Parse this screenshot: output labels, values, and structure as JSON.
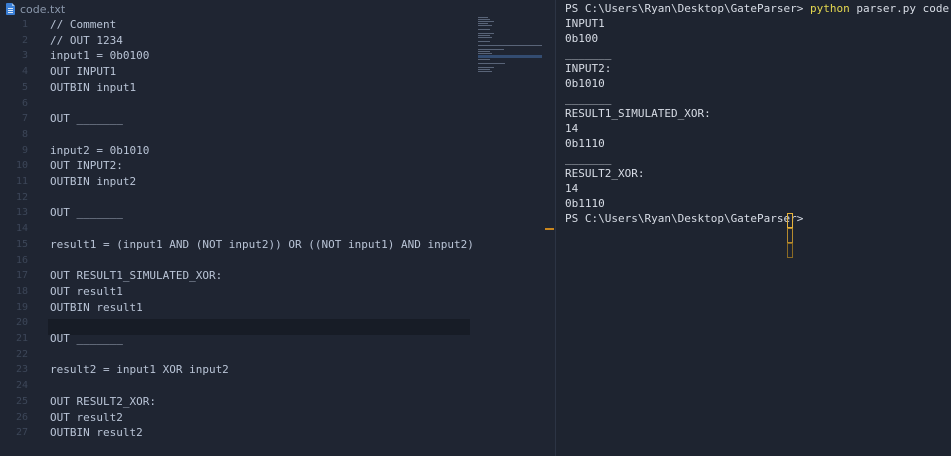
{
  "editor": {
    "tab_label": "code.txt",
    "lines": [
      {
        "num": "1",
        "text": "// Comment"
      },
      {
        "num": "2",
        "text": "// OUT 1234"
      },
      {
        "num": "3",
        "text": "input1 = 0b0100"
      },
      {
        "num": "4",
        "text": "OUT INPUT1"
      },
      {
        "num": "5",
        "text": "OUTBIN input1"
      },
      {
        "num": "6",
        "text": ""
      },
      {
        "num": "7",
        "text": "OUT _______"
      },
      {
        "num": "8",
        "text": ""
      },
      {
        "num": "9",
        "text": "input2 = 0b1010"
      },
      {
        "num": "10",
        "text": "OUT INPUT2:"
      },
      {
        "num": "11",
        "text": "OUTBIN input2"
      },
      {
        "num": "12",
        "text": ""
      },
      {
        "num": "13",
        "text": "OUT _______"
      },
      {
        "num": "14",
        "text": ""
      },
      {
        "num": "15",
        "text": "result1 = (input1 AND (NOT input2)) OR ((NOT input1) AND input2)"
      },
      {
        "num": "16",
        "text": ""
      },
      {
        "num": "17",
        "text": "OUT RESULT1_SIMULATED_XOR:"
      },
      {
        "num": "18",
        "text": "OUT result1"
      },
      {
        "num": "19",
        "text": "OUTBIN result1"
      },
      {
        "num": "20",
        "text": ""
      },
      {
        "num": "21",
        "text": "OUT _______"
      },
      {
        "num": "22",
        "text": ""
      },
      {
        "num": "23",
        "text": "result2 = input1 XOR input2"
      },
      {
        "num": "24",
        "text": ""
      },
      {
        "num": "25",
        "text": "OUT RESULT2_XOR:"
      },
      {
        "num": "26",
        "text": "OUT result2"
      },
      {
        "num": "27",
        "text": "OUTBIN result2"
      }
    ]
  },
  "terminal": {
    "prompt": "PS C:\\Users\\Ryan\\Desktop\\GateParser> ",
    "command_name": "python",
    "command_args": " parser.py code.txt",
    "output": [
      "INPUT1",
      "0b100",
      "_______",
      "INPUT2:",
      "0b1010",
      "_______",
      "RESULT1_SIMULATED_XOR:",
      "14",
      "0b1110",
      "_______",
      "RESULT2_XOR:",
      "14",
      "0b1110"
    ],
    "final_prompt": "PS C:\\Users\\Ryan\\Desktop\\GateParser>"
  },
  "colors": {
    "editor_bg": "#1f2532",
    "terminal_bg": "#1e2430",
    "command_highlight": "#e5d84f",
    "cursor": "#e6b23c"
  }
}
